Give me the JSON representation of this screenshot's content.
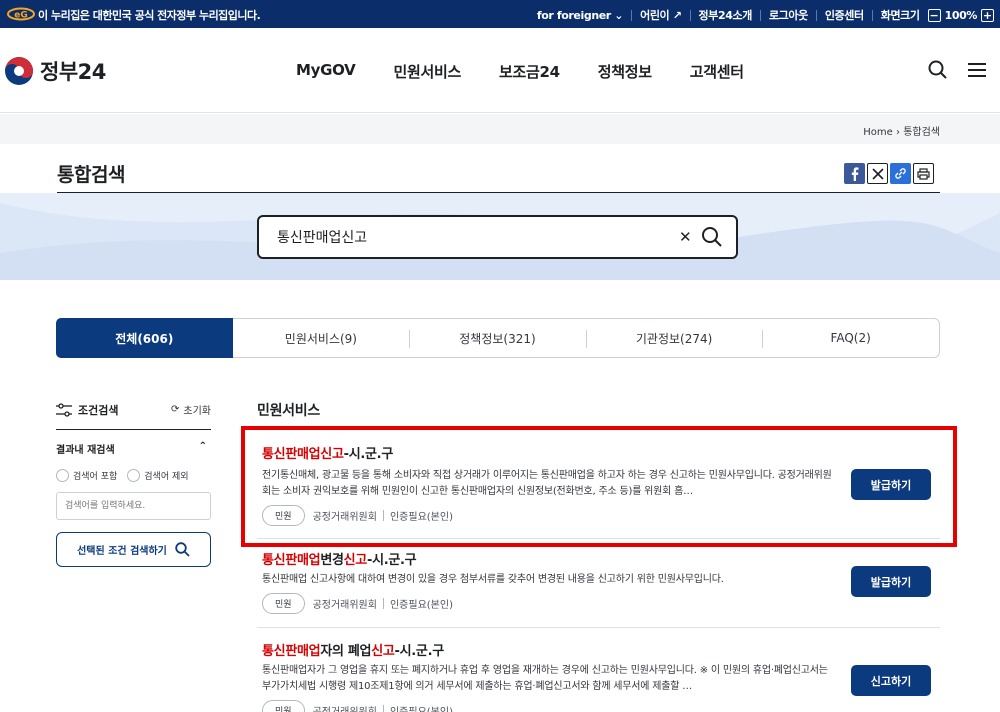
{
  "topbar": {
    "official": "이 누리집은 대한민국 공식 전자정부 누리집입니다.",
    "foreigner": "for foreigner",
    "kids": "어린이",
    "about": "정부24소개",
    "logout": "로그아웃",
    "cert": "인증센터",
    "zoom_label": "화면크기",
    "zoom_value": "100%"
  },
  "header": {
    "logo_text": "정부24",
    "nav": [
      "MyGOV",
      "민원서비스",
      "보조금24",
      "정책정보",
      "고객센터"
    ]
  },
  "breadcrumb": {
    "home": "Home",
    "current": "통합검색"
  },
  "page": {
    "title": "통합검색"
  },
  "search": {
    "query": "통신판매업신고"
  },
  "tabs": [
    "전체(606)",
    "민원서비스(9)",
    "정책정보(321)",
    "기관정보(274)",
    "FAQ(2)"
  ],
  "sidebar": {
    "title": "조건검색",
    "reset": "초기화",
    "subtitle": "결과내 재검색",
    "include": "검색어 포함",
    "exclude": "검색어 제외",
    "placeholder": "검색어를 입력하세요.",
    "apply": "선택된 조건 검색하기"
  },
  "results": {
    "section_title": "민원서비스",
    "items": [
      {
        "title_parts": [
          "통신판매업신고",
          "-시.군.구"
        ],
        "desc": "전기통신매체, 광고물 등을 통해 소비자와 직접 상거래가 이루어지는 통신판매업을 하고자 하는 경우 신고하는 민원사무입니다. 공정거래위원회는 소비자 권익보호를 위해 민원인이 신고한 통신판매업자의 신원정보(전화번호, 주소 등)를 위원회 홈…",
        "tag": "민원",
        "org": "공정거래위원회",
        "auth": "인증필요(본인)",
        "action": "발급하기"
      },
      {
        "title_parts": [
          "통신판매업",
          "변경",
          "신고",
          "-시.군.구"
        ],
        "desc": "통신판매업 신고사항에 대하여 변경이 있을 경우 첨부서류를 갖추어 변경된 내용을 신고하기 위한 민원사무입니다.",
        "tag": "민원",
        "org": "공정거래위원회",
        "auth": "인증필요(본인)",
        "action": "발급하기"
      },
      {
        "title_parts": [
          "통신판매업",
          "자의 폐업",
          "신고",
          "-시.군.구"
        ],
        "desc": "통신판매업자가 그 영업을 휴지 또는 폐지하거나 휴업 후 영업을 재개하는 경우에 신고하는 민원사무입니다. ※ 이 민원의 휴업·폐업신고서는 부가가치세법 시행령 제10조제1항에 의거 세무서에 제출하는 휴업·폐업신고서와 함께 세무서에 제출할 …",
        "tag": "민원",
        "org": "공정거래위원회",
        "auth": "인증필요(본인)",
        "action": "신고하기"
      }
    ]
  },
  "colors": {
    "navy": "#0b2e6b",
    "primary": "#0b3a7e",
    "highlight": "#d50000",
    "annotation": "#e60000"
  }
}
